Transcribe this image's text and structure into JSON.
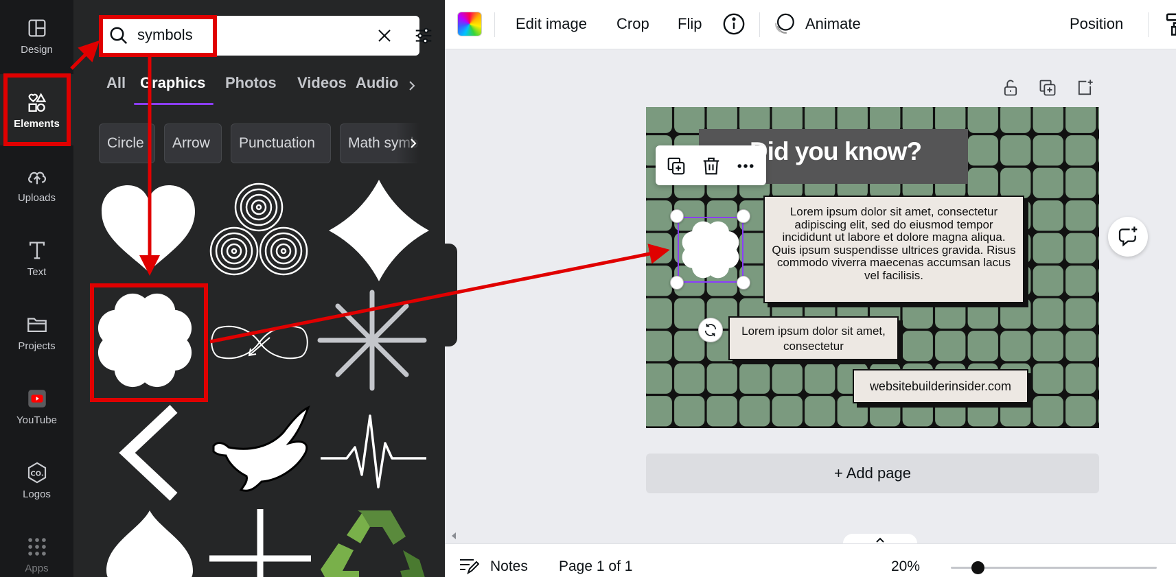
{
  "rail": {
    "items": [
      {
        "label": "Design",
        "icon": "design-layout-icon"
      },
      {
        "label": "Elements",
        "icon": "elements-shapes-icon"
      },
      {
        "label": "Uploads",
        "icon": "cloud-upload-icon"
      },
      {
        "label": "Text",
        "icon": "text-t-icon"
      },
      {
        "label": "Projects",
        "icon": "folder-icon"
      },
      {
        "label": "YouTube",
        "icon": "youtube-icon"
      },
      {
        "label": "Logos",
        "icon": "logo-co-icon"
      },
      {
        "label": "Apps",
        "icon": "apps-grid-icon"
      }
    ],
    "active_index": 1
  },
  "panel": {
    "search": {
      "value": "symbols"
    },
    "tabs": [
      "All",
      "Graphics",
      "Photos",
      "Videos",
      "Audio"
    ],
    "active_tab": "Graphics",
    "chips": [
      "Circle",
      "Arrow",
      "Punctuation",
      "Math symbols"
    ],
    "elements": [
      "heart",
      "triple-spiral",
      "diamond",
      "clover",
      "infinity",
      "asterisk",
      "chevron-left",
      "dove",
      "heartbeat",
      "spade",
      "cross",
      "recycle"
    ]
  },
  "topbar": {
    "edit_image": "Edit image",
    "crop": "Crop",
    "flip": "Flip",
    "animate": "Animate",
    "position": "Position"
  },
  "canvas": {
    "title": "Did you know?",
    "card1": "Lorem ipsum dolor sit amet, consectetur adipiscing elit, sed do eiusmod tempor incididunt ut labore et dolore magna aliqua. Quis ipsum suspendisse ultrices gravida. Risus commodo viverra maecenas accumsan lacus vel facilisis.",
    "card2": "Lorem ipsum dolor sit amet, consectetur",
    "card3": "websitebuilderinsider.com",
    "add_page": "+ Add page"
  },
  "bottom": {
    "notes": "Notes",
    "page_indicator": "Page 1 of 1",
    "zoom": "20%",
    "zoom_value": 20
  },
  "colors": {
    "accent": "#8b3dff",
    "annotation": "#e00000",
    "page_green": "#7b9a7f",
    "sidebar": "#18191b",
    "panel": "#252627"
  }
}
